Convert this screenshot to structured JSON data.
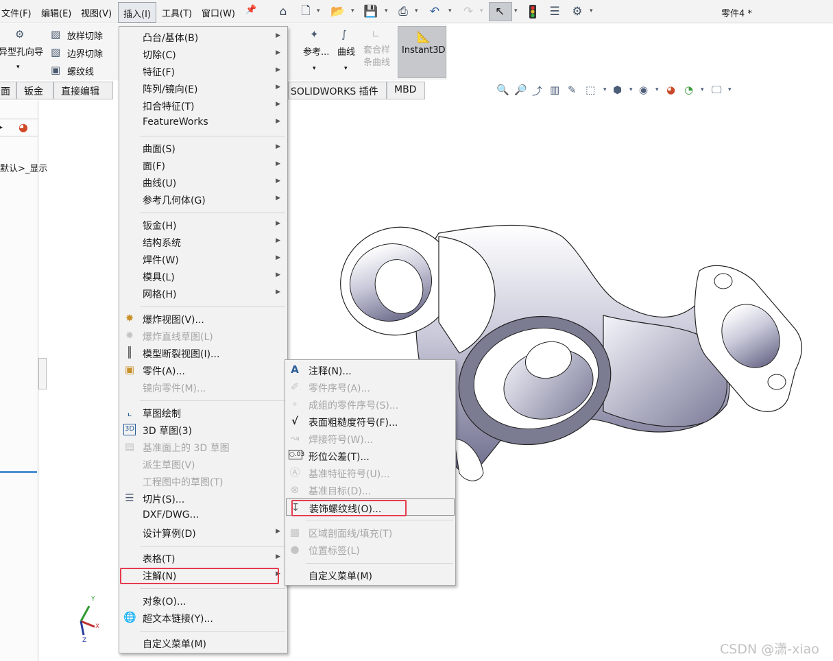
{
  "menubar": {
    "items": [
      "文件(F)",
      "编辑(E)",
      "视图(V)",
      "插入(I)",
      "工具(T)",
      "窗口(W)"
    ],
    "document_title": "零件4 *"
  },
  "command_manager": {
    "left_labels": [
      "异型孔向导"
    ],
    "buttons": [
      "放样切除",
      "边界切除",
      "螺纹线"
    ],
    "right_labels": [
      "参考...",
      "曲线",
      "套合样条曲线",
      "Instant3D"
    ]
  },
  "tabs": [
    "面",
    "钣金",
    "直接编辑",
    "SOLIDWORKS 插件",
    "MBD"
  ],
  "left_panel": {
    "config_text": "默认>_显示"
  },
  "insert_menu": {
    "items": [
      {
        "label": "凸台/基体(B)",
        "submenu": true
      },
      {
        "label": "切除(C)",
        "submenu": true
      },
      {
        "label": "特征(F)",
        "submenu": true
      },
      {
        "label": "阵列/镜向(E)",
        "submenu": true
      },
      {
        "label": "扣合特征(T)",
        "submenu": true
      },
      {
        "label": "FeatureWorks",
        "submenu": true
      },
      {
        "label": "曲面(S)",
        "submenu": true
      },
      {
        "label": "面(F)",
        "submenu": true
      },
      {
        "label": "曲线(U)",
        "submenu": true
      },
      {
        "label": "参考几何体(G)",
        "submenu": true
      },
      {
        "label": "钣金(H)",
        "submenu": true
      },
      {
        "label": "结构系统",
        "submenu": true
      },
      {
        "label": "焊件(W)",
        "submenu": true
      },
      {
        "label": "模具(L)",
        "submenu": true
      },
      {
        "label": "网格(H)",
        "submenu": true
      },
      {
        "label": "爆炸视图(V)...",
        "icon": "explode-view-icon"
      },
      {
        "label": "爆炸直线草图(L)",
        "disabled": true,
        "icon": "explode-line-sketch-icon"
      },
      {
        "label": "模型断裂视图(I)...",
        "icon": "broken-view-icon"
      },
      {
        "label": "零件(A)...",
        "icon": "insert-part-icon"
      },
      {
        "label": "镜向零件(M)...",
        "disabled": true
      },
      {
        "label": "草图绘制",
        "icon": "sketch-icon"
      },
      {
        "label": "3D 草图(3)",
        "icon": "3d-sketch-icon"
      },
      {
        "label": "基准面上的 3D 草图",
        "disabled": true,
        "icon": "3d-sketch-on-plane-icon"
      },
      {
        "label": "派生草图(V)",
        "disabled": true
      },
      {
        "label": "工程图中的草图(T)",
        "disabled": true
      },
      {
        "label": "切片(S)...",
        "icon": "slice-icon"
      },
      {
        "label": "DXF/DWG..."
      },
      {
        "label": "设计算例(D)",
        "submenu": true
      },
      {
        "label": "表格(T)",
        "submenu": true
      },
      {
        "label": "注解(N)",
        "submenu": true,
        "highlighted": true
      },
      {
        "label": "对象(O)..."
      },
      {
        "label": "超文本链接(Y)...",
        "icon": "hyperlink-icon"
      },
      {
        "label": "自定义菜单(M)"
      }
    ]
  },
  "annotation_menu": {
    "items": [
      {
        "label": "注释(N)...",
        "icon": "note-icon"
      },
      {
        "label": "零件序号(A)...",
        "disabled": true,
        "icon": "balloon-icon"
      },
      {
        "label": "成组的零件序号(S)...",
        "disabled": true,
        "icon": "stacked-balloon-icon"
      },
      {
        "label": "表面粗糙度符号(F)...",
        "icon": "surface-finish-icon"
      },
      {
        "label": "焊接符号(W)...",
        "disabled": true,
        "icon": "weld-symbol-icon"
      },
      {
        "label": "形位公差(T)...",
        "icon": "geometric-tolerance-icon"
      },
      {
        "label": "基准特征符号(U)...",
        "disabled": true,
        "icon": "datum-feature-icon"
      },
      {
        "label": "基准目标(D)...",
        "disabled": true,
        "icon": "datum-target-icon"
      },
      {
        "label": "装饰螺纹线(O)...",
        "icon": "cosmetic-thread-icon",
        "highlighted": true
      },
      {
        "label": "区域剖面线/填充(T)",
        "disabled": true,
        "icon": "area-hatch-icon"
      },
      {
        "label": "位置标签(L)",
        "disabled": true,
        "icon": "location-label-icon"
      },
      {
        "label": "自定义菜单(M)"
      }
    ]
  },
  "triad": {
    "x": "X",
    "y": "Y",
    "z": "Z"
  },
  "watermark": "CSDN @潇-xiao",
  "colors": {
    "highlight_box": "#e63b4f",
    "menu_bg": "#f2f2f2",
    "model_shade": "#8a8aa6"
  }
}
